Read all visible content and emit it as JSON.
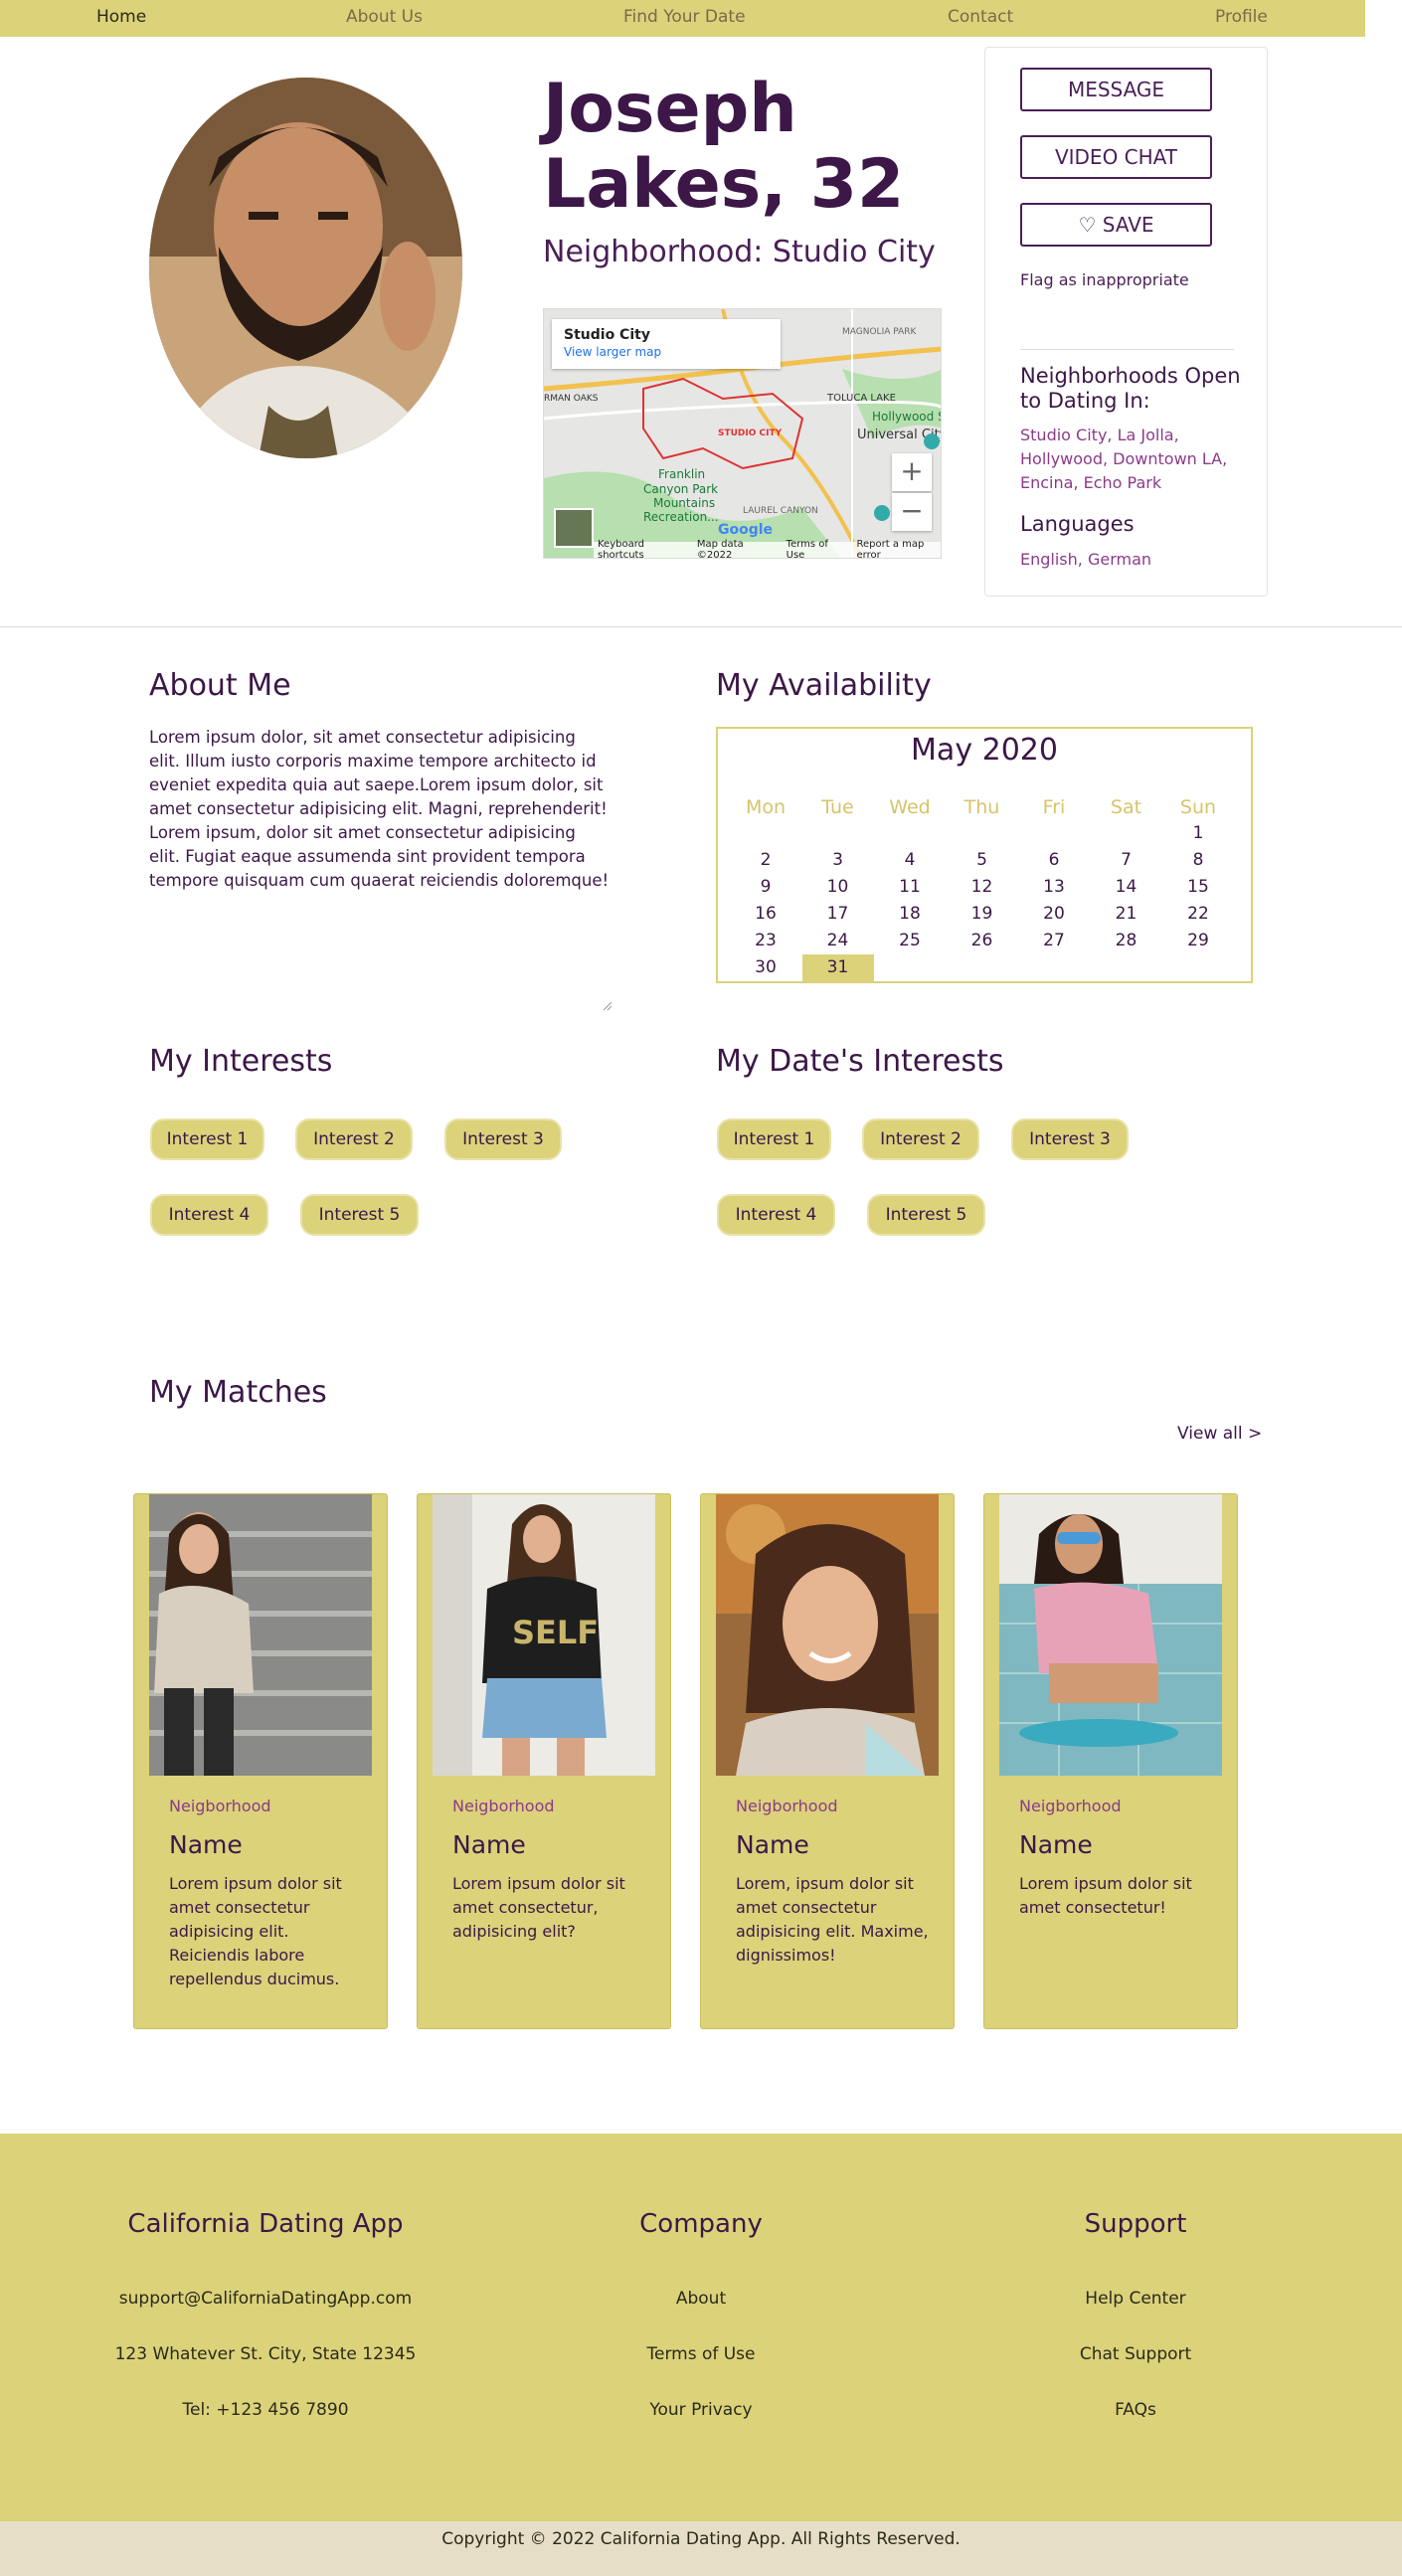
{
  "nav": {
    "items": [
      "Home",
      "About Us",
      "Find Your Date",
      "Contact",
      "Profile"
    ],
    "active": "Home"
  },
  "profile": {
    "name": "Joseph Lakes, 32",
    "neighborhood": "Neighborhood: Studio City"
  },
  "map": {
    "place": "Studio City",
    "larger_link": "View larger map",
    "zoom_in": "+",
    "zoom_out": "−",
    "footer": [
      "Keyboard shortcuts",
      "Map data ©2022",
      "Terms of Use",
      "Report a map error"
    ],
    "labels": [
      "MAGNOLIA PARK",
      "TOLUCA LAKE",
      "Hollywood S",
      "Universal City",
      "STUDIO CITY",
      "RMAN OAKS",
      "Franklin Canyon Park Mountains Recreation...",
      "LAUREL CANYON",
      "Google"
    ]
  },
  "actions": {
    "message": "MESSAGE",
    "video_chat": "VIDEO CHAT",
    "save": "SAVE",
    "flag": "Flag as inappropriate"
  },
  "sidebar": {
    "neighborhoods_heading": "Neighborhoods Open to Dating In:",
    "neighborhoods": "Studio City, La Jolla, Hollywood, Downtown LA, Encina, Echo Park",
    "languages_heading": "Languages",
    "languages": "English, German"
  },
  "about": {
    "heading": "About Me",
    "text": "Lorem ipsum dolor, sit amet consectetur adipisicing elit. Illum iusto corporis maxime tempore architecto id eveniet expedita quia aut saepe.Lorem ipsum dolor, sit amet consectetur adipisicing elit. Magni, reprehenderit! Lorem ipsum, dolor sit amet consectetur adipisicing elit. Fugiat eaque assumenda sint provident tempora tempore quisquam cum quaerat reiciendis doloremque!"
  },
  "availability": {
    "heading": "My Availability",
    "month": "May 2020",
    "weekdays": [
      "Mon",
      "Tue",
      "Wed",
      "Thu",
      "Fri",
      "Sat",
      "Sun"
    ],
    "weeks": [
      [
        "",
        "",
        "",
        "",
        "",
        "",
        "1"
      ],
      [
        "2",
        "3",
        "4",
        "5",
        "6",
        "7",
        "8"
      ],
      [
        "9",
        "10",
        "11",
        "12",
        "13",
        "14",
        "15"
      ],
      [
        "16",
        "17",
        "18",
        "19",
        "20",
        "21",
        "22"
      ],
      [
        "23",
        "24",
        "25",
        "26",
        "27",
        "28",
        "29"
      ],
      [
        "30",
        "31",
        "",
        "",
        "",
        "",
        ""
      ]
    ],
    "highlighted": "31"
  },
  "interests": {
    "heading": "My Interests",
    "items": [
      "Interest 1",
      "Interest 2",
      "Interest 3",
      "Interest 4",
      "Interest 5"
    ]
  },
  "date_interests": {
    "heading": "My Date's Interests",
    "items": [
      "Interest 1",
      "Interest 2",
      "Interest 3",
      "Interest 4",
      "Interest 5"
    ]
  },
  "matches": {
    "heading": "My Matches",
    "view_all": "View all >",
    "cards": [
      {
        "neighborhood": "Neigborhood",
        "name": "Name",
        "desc": "Lorem ipsum dolor sit amet consectetur adipisicing elit. Reiciendis labore repellendus ducimus."
      },
      {
        "neighborhood": "Neigborhood",
        "name": "Name",
        "desc": "Lorem ipsum dolor sit amet consectetur, adipisicing elit?"
      },
      {
        "neighborhood": "Neigborhood",
        "name": "Name",
        "desc": "Lorem, ipsum dolor sit amet consectetur adipisicing elit. Maxime, dignissimos!"
      },
      {
        "neighborhood": "Neigborhood",
        "name": "Name",
        "desc": "Lorem ipsum dolor sit amet consectetur!"
      }
    ]
  },
  "footer": {
    "col1": {
      "heading": "California Dating App",
      "items": [
        "support@CaliforniaDatingApp.com",
        "123 Whatever St. City, State 12345",
        "Tel: +123 456 7890"
      ]
    },
    "col2": {
      "heading": "Company",
      "items": [
        "About",
        "Terms of Use",
        "Your Privacy"
      ]
    },
    "col3": {
      "heading": "Support",
      "items": [
        "Help Center",
        "Chat Support",
        "FAQs"
      ]
    },
    "copyright": "Copyright © 2022 California Dating App. All Rights Reserved."
  },
  "colors": {
    "accent": "#dbd27a",
    "text": "#3c1747",
    "link": "#8c3b8a",
    "copyright_bg": "#e6dec7"
  }
}
